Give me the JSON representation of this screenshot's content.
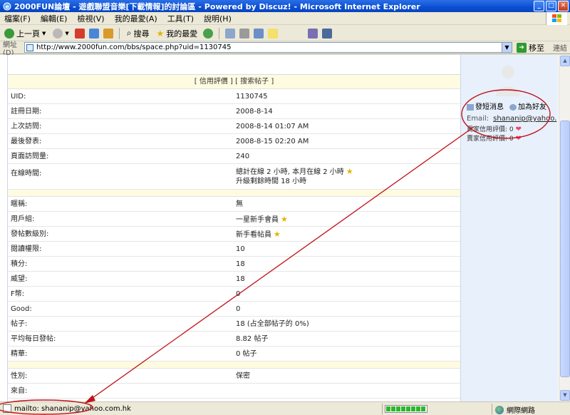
{
  "window": {
    "title": "2000FUN論壇 - 遊戲聯盟音樂[下載情報]的討論區 - Powered by Discuz! - Microsoft Internet Explorer"
  },
  "menu": [
    "檔案(F)",
    "編輯(E)",
    "檢視(V)",
    "我的最愛(A)",
    "工具(T)",
    "說明(H)"
  ],
  "toolbar": {
    "back": "上一頁",
    "search": "搜尋",
    "favorites": "我的最愛"
  },
  "address": {
    "label": "網址(D)",
    "url": "http://www.2000fun.com/bbs/space.php?uid=1130745",
    "go": "移至",
    "links": "連結"
  },
  "profile": {
    "header_links": "[ 信用評價 ] [ 搜索帖子 ]",
    "rows_a": [
      {
        "label": "UID:",
        "value": "1130745"
      },
      {
        "label": "註冊日期:",
        "value": "2008-8-14"
      },
      {
        "label": "上次訪問:",
        "value": "2008-8-14 01:07 AM"
      },
      {
        "label": "最後發表:",
        "value": "2008-8-15 02:20 AM"
      },
      {
        "label": "頁面訪問量:",
        "value": "240"
      }
    ],
    "online_label": "在線時間:",
    "online_line1": "總計在線 2 小時, 本月在線 2 小時",
    "online_line2": "升級剩餘時間 18 小時",
    "rows_b": [
      {
        "label": "暱稱:",
        "value": "無"
      },
      {
        "label": "用戶組:",
        "value": "一星新手會員"
      },
      {
        "label": "發帖數級別:",
        "value": "新手看帖員"
      },
      {
        "label": "閱讀權限:",
        "value": "10"
      },
      {
        "label": "積分:",
        "value": "18"
      },
      {
        "label": "威望:",
        "value": "18"
      },
      {
        "label": "F幣:",
        "value": "0"
      },
      {
        "label": "Good:",
        "value": "0"
      },
      {
        "label": "帖子:",
        "value": "18 (占全部帖子的 0%)"
      },
      {
        "label": "平均每日發帖:",
        "value": "8.82 帖子"
      },
      {
        "label": "精華:",
        "value": "0 帖子"
      }
    ],
    "rows_c": [
      {
        "label": "性別:",
        "value": "保密"
      },
      {
        "label": "來自:",
        "value": ""
      }
    ]
  },
  "sidebar": {
    "send_pm": "發短消息",
    "add_friend": "加為好友",
    "email_label": "Email:",
    "email_value": "shananip@yahoo.",
    "buyer_credit": "買家信用評價:",
    "buyer_value": "0",
    "seller_credit": "賣家信用評價:",
    "seller_value": "0"
  },
  "status": {
    "text": "mailto: shananip@yahoo.com.hk",
    "zone": "網際網路"
  },
  "colors": {
    "annotation": "#c0121a",
    "titlebar": "#0a4fd1"
  }
}
